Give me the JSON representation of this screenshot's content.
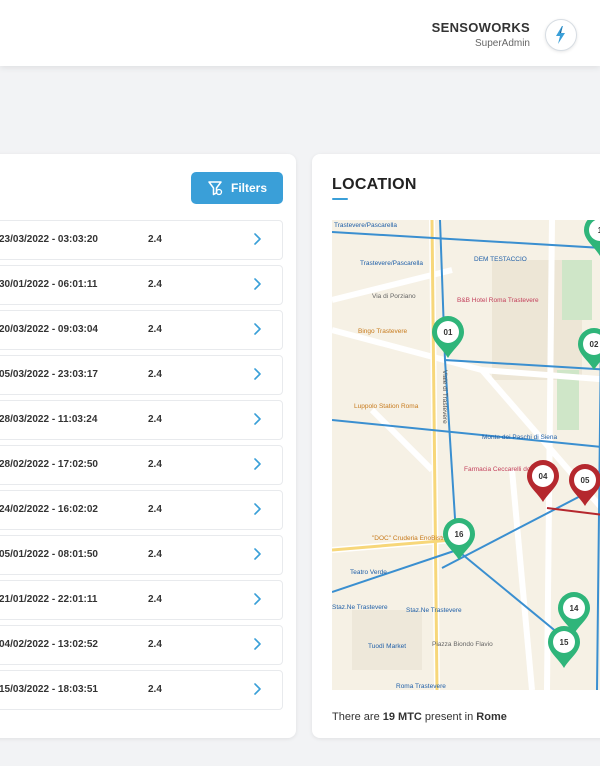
{
  "header": {
    "company": "SENSOWORKS",
    "role": "SuperAdmin",
    "logo_icon": "sensoworks-logo-icon"
  },
  "list": {
    "filters_label": "Filters",
    "filters_icon": "filter-icon",
    "rows": [
      {
        "date": "23/03/2022 - 03:03:20",
        "value": "2.4"
      },
      {
        "date": "30/01/2022 - 06:01:11",
        "value": "2.4"
      },
      {
        "date": "20/03/2022 - 09:03:04",
        "value": "2.4"
      },
      {
        "date": "05/03/2022 - 23:03:17",
        "value": "2.4"
      },
      {
        "date": "28/03/2022 - 11:03:24",
        "value": "2.4"
      },
      {
        "date": "28/02/2022 - 17:02:50",
        "value": "2.4"
      },
      {
        "date": "24/02/2022 - 16:02:02",
        "value": "2.4"
      },
      {
        "date": "05/01/2022 - 08:01:50",
        "value": "2.4"
      },
      {
        "date": "21/01/2022 - 22:01:11",
        "value": "2.4"
      },
      {
        "date": "04/02/2022 - 13:02:52",
        "value": "2.4"
      },
      {
        "date": "15/03/2022 - 18:03:51",
        "value": "2.4"
      }
    ]
  },
  "location": {
    "title": "LOCATION",
    "caption_prefix": "There are ",
    "caption_count": "19 MTC",
    "caption_middle": " present in ",
    "caption_city": "Rome",
    "map": {
      "places": [
        "Trastevere/Pascarella",
        "DEM TESTACCIO",
        "Via di Porziano",
        "B&B Hotel Roma Trastevere",
        "Bingo Trastevere",
        "Luppolo Station Roma",
        "Monte dei Paschi di Siena",
        "Farmacia Ceccarelli dott. Matteo",
        "\"DOC\" Cruderia EnoBistrot",
        "Teatro Verde",
        "Staz.Ne Trastevere",
        "Tuodì Market",
        "Piazza Biondo Flavio",
        "Roma Trastevere",
        "Viale di Trastevere"
      ],
      "markers": [
        {
          "label": "01",
          "color": "#2fb57a"
        },
        {
          "label": "02",
          "color": "#2fb57a"
        },
        {
          "label": "04",
          "color": "#b5282e"
        },
        {
          "label": "05",
          "color": "#b5282e"
        },
        {
          "label": "14",
          "color": "#2fb57a"
        },
        {
          "label": "15",
          "color": "#2fb57a"
        },
        {
          "label": "16",
          "color": "#2fb57a"
        },
        {
          "label": "1",
          "color": "#2fb57a"
        }
      ]
    }
  },
  "colors": {
    "accent": "#3a9fd8",
    "marker_green": "#2fb57a",
    "marker_red": "#b5282e",
    "route_blue": "#3a8fd0"
  }
}
